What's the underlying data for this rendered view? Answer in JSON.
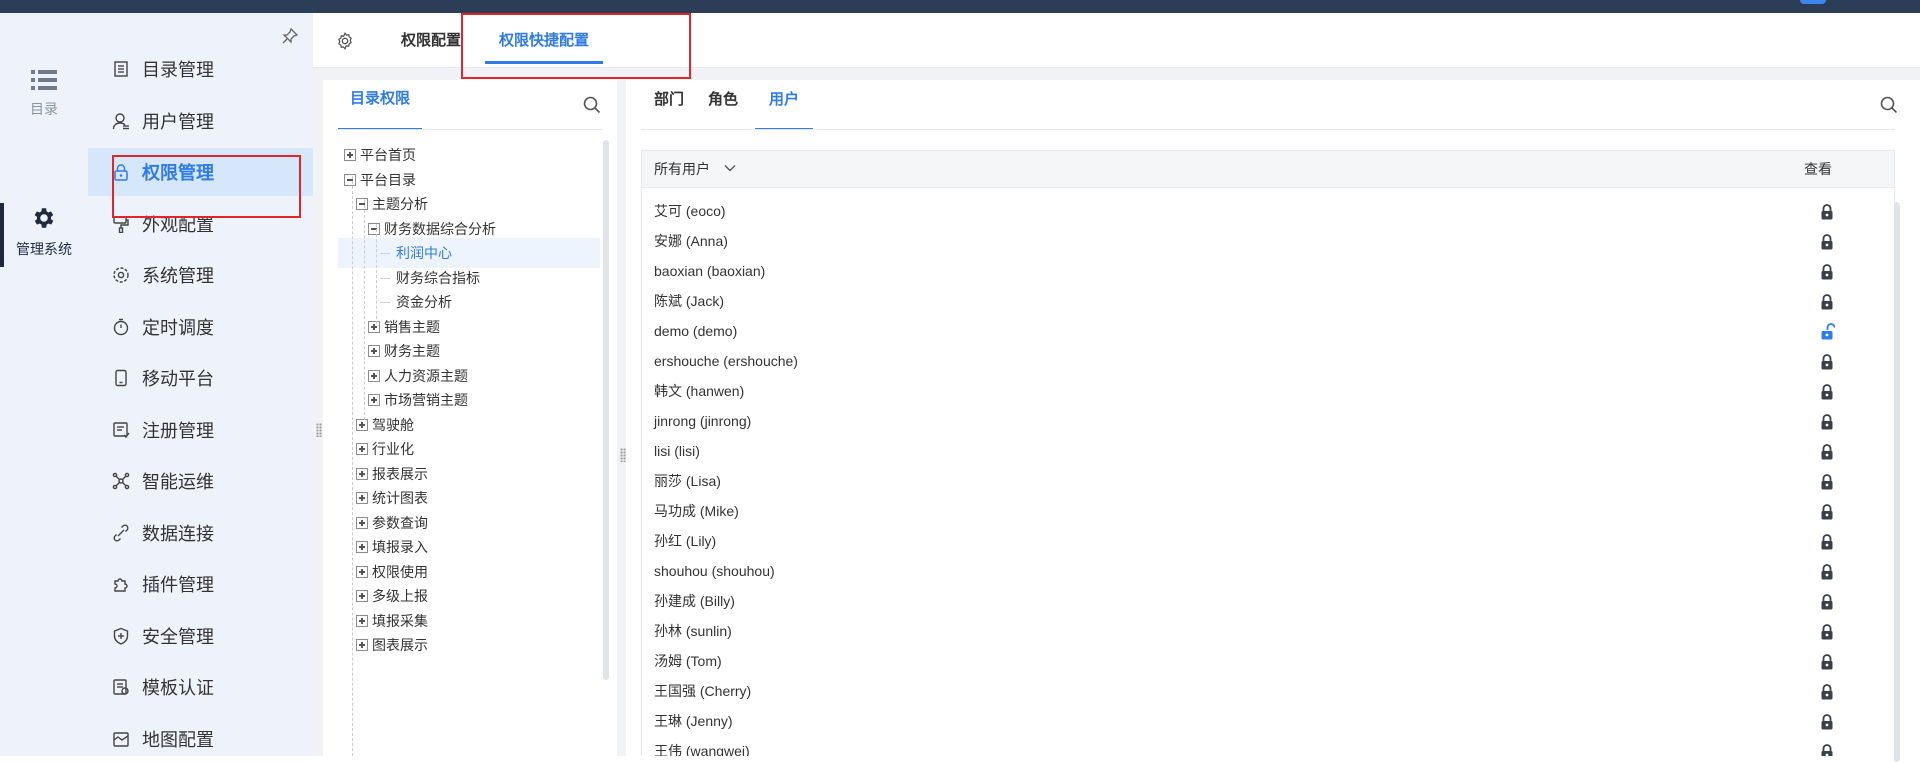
{
  "rail": {
    "catalog_label": "目录",
    "system_label": "管理系统"
  },
  "menu": [
    {
      "label": "目录管理",
      "icon": "catalog-icon"
    },
    {
      "label": "用户管理",
      "icon": "user-icon"
    },
    {
      "label": "权限管理",
      "icon": "lock-icon",
      "active": true
    },
    {
      "label": "外观配置",
      "icon": "brush-icon"
    },
    {
      "label": "系统管理",
      "icon": "gear-icon"
    },
    {
      "label": "定时调度",
      "icon": "timer-icon"
    },
    {
      "label": "移动平台",
      "icon": "mobile-icon"
    },
    {
      "label": "注册管理",
      "icon": "register-icon"
    },
    {
      "label": "智能运维",
      "icon": "network-icon"
    },
    {
      "label": "数据连接",
      "icon": "link-icon"
    },
    {
      "label": "插件管理",
      "icon": "puzzle-icon"
    },
    {
      "label": "安全管理",
      "icon": "shield-icon"
    },
    {
      "label": "模板认证",
      "icon": "template-icon"
    },
    {
      "label": "地图配置",
      "icon": "map-icon"
    }
  ],
  "tabs": {
    "perm_config": "权限配置",
    "quick_config": "权限快捷配置"
  },
  "tree_pane": {
    "tab_label": "目录权限",
    "nodes": [
      {
        "label": "平台首页",
        "level": 0,
        "toggle": "plus"
      },
      {
        "label": "平台目录",
        "level": 0,
        "toggle": "minus"
      },
      {
        "label": "主题分析",
        "level": 1,
        "toggle": "minus"
      },
      {
        "label": "财务数据综合分析",
        "level": 2,
        "toggle": "minus"
      },
      {
        "label": "利润中心",
        "level": 3,
        "toggle": "none",
        "selected": true
      },
      {
        "label": "财务综合指标",
        "level": 3,
        "toggle": "none"
      },
      {
        "label": "资金分析",
        "level": 3,
        "toggle": "none"
      },
      {
        "label": "销售主题",
        "level": 2,
        "toggle": "plus"
      },
      {
        "label": "财务主题",
        "level": 2,
        "toggle": "plus"
      },
      {
        "label": "人力资源主题",
        "level": 2,
        "toggle": "plus"
      },
      {
        "label": "市场营销主题",
        "level": 2,
        "toggle": "plus"
      },
      {
        "label": "驾驶舱",
        "level": 1,
        "toggle": "plus"
      },
      {
        "label": "行业化",
        "level": 1,
        "toggle": "plus"
      },
      {
        "label": "报表展示",
        "level": 1,
        "toggle": "plus"
      },
      {
        "label": "统计图表",
        "level": 1,
        "toggle": "plus"
      },
      {
        "label": "参数查询",
        "level": 1,
        "toggle": "plus"
      },
      {
        "label": "填报录入",
        "level": 1,
        "toggle": "plus"
      },
      {
        "label": "权限使用",
        "level": 1,
        "toggle": "plus"
      },
      {
        "label": "多级上报",
        "level": 1,
        "toggle": "plus"
      },
      {
        "label": "填报采集",
        "level": 1,
        "toggle": "plus"
      },
      {
        "label": "图表展示",
        "level": 1,
        "toggle": "plus"
      }
    ]
  },
  "user_pane": {
    "tabs": [
      "部门",
      "角色",
      "用户"
    ],
    "active_tab": 2,
    "filter_label": "所有用户",
    "view_header": "查看",
    "lock_color": "#3a3f48",
    "unlock_color": "#2f7ce8",
    "users": [
      {
        "name": "艾可 (eoco)",
        "state": "locked"
      },
      {
        "name": "安娜 (Anna)",
        "state": "locked"
      },
      {
        "name": "baoxian (baoxian)",
        "state": "locked"
      },
      {
        "name": "陈斌 (Jack)",
        "state": "locked"
      },
      {
        "name": "demo (demo)",
        "state": "unlocked"
      },
      {
        "name": "ershouche (ershouche)",
        "state": "locked"
      },
      {
        "name": "韩文 (hanwen)",
        "state": "locked"
      },
      {
        "name": "jinrong (jinrong)",
        "state": "locked"
      },
      {
        "name": "lisi (lisi)",
        "state": "locked"
      },
      {
        "name": "丽莎 (Lisa)",
        "state": "locked"
      },
      {
        "name": "马功成 (Mike)",
        "state": "locked"
      },
      {
        "name": "孙红 (Lily)",
        "state": "locked"
      },
      {
        "name": "shouhou (shouhou)",
        "state": "locked"
      },
      {
        "name": "孙建成 (Billy)",
        "state": "locked"
      },
      {
        "name": "孙林 (sunlin)",
        "state": "locked"
      },
      {
        "name": "汤姆 (Tom)",
        "state": "locked"
      },
      {
        "name": "王国强 (Cherry)",
        "state": "locked"
      },
      {
        "name": "王琳 (Jenny)",
        "state": "locked"
      },
      {
        "name": "王伟 (wangwei)",
        "state": "locked"
      }
    ]
  }
}
